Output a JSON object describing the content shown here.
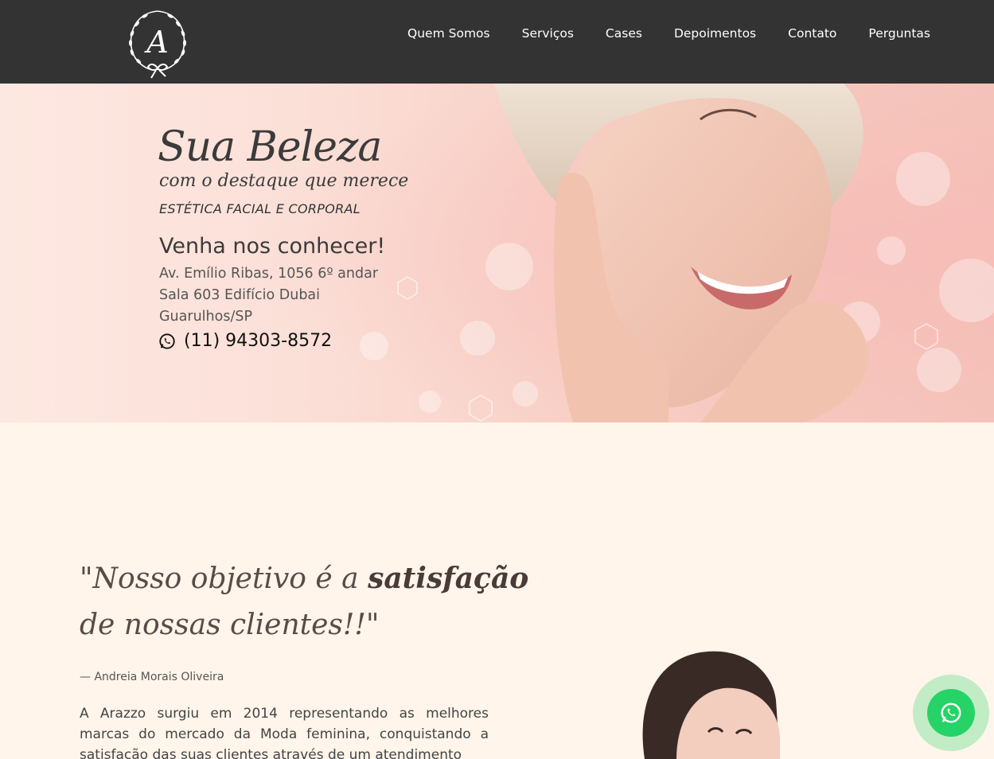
{
  "header": {
    "logo_alt": "A",
    "nav": [
      "Quem Somos",
      "Serviços",
      "Cases",
      "Depoimentos",
      "Contato",
      "Perguntas"
    ]
  },
  "hero": {
    "title": "Sua Beleza",
    "subtitle": "com o destaque que merece",
    "kicker": "ESTÉTICA FACIAL E CORPORAL",
    "visit": "Venha nos conhecer!",
    "address": [
      "Av. Emílio Ribas, 1056 6º andar",
      "Sala 603 Edifício Dubai",
      "Guarulhos/SP"
    ],
    "phone": "(11) 94303-8572"
  },
  "about": {
    "quote_part1": "\"Nosso objetivo é a ",
    "quote_bold": "satisfação",
    "quote_part2": "de nossas clientes!!\"",
    "author": "— Andreia Morais Oliveira",
    "text": "A Arazzo surgiu em 2014 representando as melhores marcas do mercado da Moda feminina, conquistando a satisfação das suas clientes através de um atendimento"
  },
  "colors": {
    "header": "#333333",
    "page_bg": "#fff5ea",
    "whatsapp": "#25d366"
  },
  "icons": {
    "phone": "whatsapp-icon",
    "float": "whatsapp-icon"
  }
}
